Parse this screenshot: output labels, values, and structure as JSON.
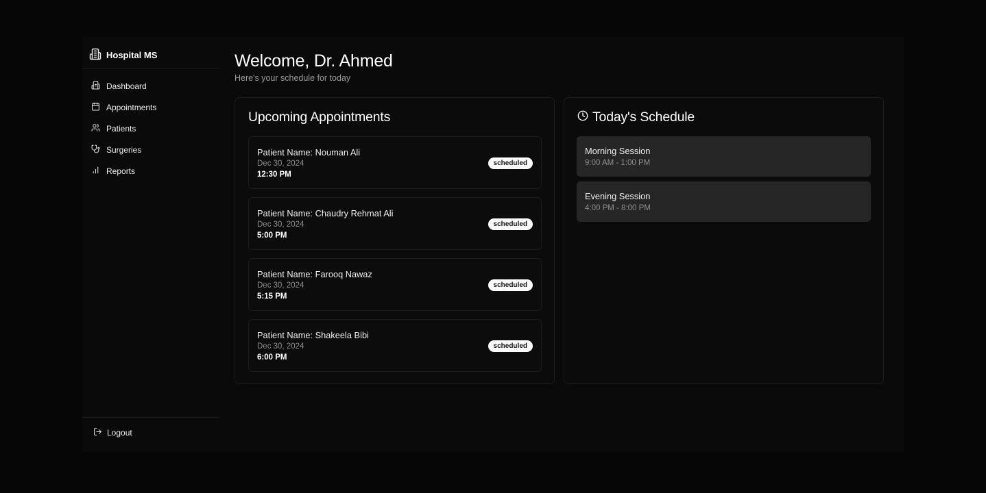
{
  "sidebar": {
    "brand": "Hospital MS",
    "items": [
      {
        "label": "Dashboard",
        "icon": "dashboard-icon"
      },
      {
        "label": "Appointments",
        "icon": "calendar-icon"
      },
      {
        "label": "Patients",
        "icon": "users-icon"
      },
      {
        "label": "Surgeries",
        "icon": "stethoscope-icon"
      },
      {
        "label": "Reports",
        "icon": "bar-chart-icon"
      }
    ],
    "logout": "Logout"
  },
  "header": {
    "title": "Welcome, Dr. Ahmed",
    "subtitle": "Here's your schedule for today"
  },
  "appointments": {
    "title": "Upcoming Appointments",
    "items": [
      {
        "patient": "Patient Name: Nouman Ali",
        "date": "Dec 30, 2024",
        "time": "12:30 PM",
        "status": "scheduled"
      },
      {
        "patient": "Patient Name: Chaudry Rehmat Ali",
        "date": "Dec 30, 2024",
        "time": "5:00 PM",
        "status": "scheduled"
      },
      {
        "patient": "Patient Name: Farooq Nawaz",
        "date": "Dec 30, 2024",
        "time": "5:15 PM",
        "status": "scheduled"
      },
      {
        "patient": "Patient Name: Shakeela Bibi",
        "date": "Dec 30, 2024",
        "time": "6:00 PM",
        "status": "scheduled"
      }
    ]
  },
  "schedule": {
    "title": "Today's Schedule",
    "sessions": [
      {
        "name": "Morning Session",
        "time": "9:00 AM - 1:00 PM"
      },
      {
        "name": "Evening Session",
        "time": "4:00 PM - 8:00 PM"
      }
    ]
  },
  "colors": {
    "background": "#060606",
    "panel": "#0a0a0a",
    "session_bg": "#262626",
    "badge_bg": "#ffffff",
    "muted_text": "#8c8c8c"
  }
}
